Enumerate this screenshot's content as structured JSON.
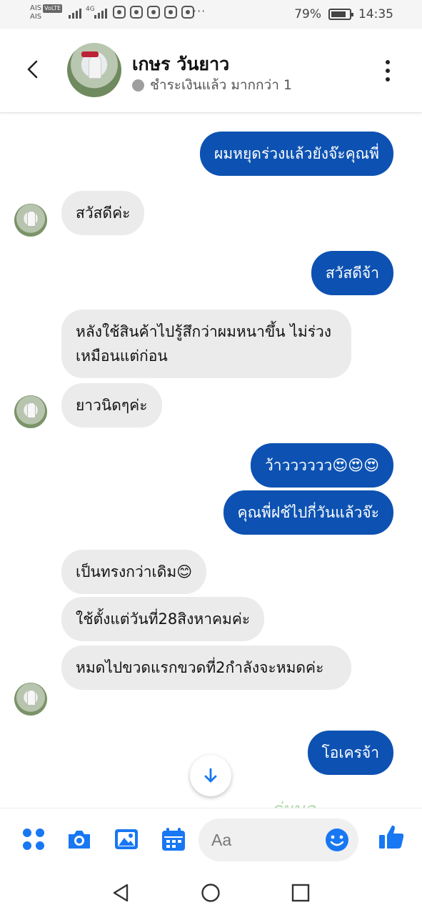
{
  "status_bar": {
    "carrier_top": "AIS",
    "volte": "VoLTE",
    "carrier_bottom": "AIS",
    "net_type": "4G",
    "dots": "···",
    "battery_percent": "79%",
    "time": "14:35"
  },
  "header": {
    "contact_name": "เกษร วันยาว",
    "status_text": "ชำระเงินแล้ว มากกว่า 1"
  },
  "messages": [
    {
      "dir": "out",
      "text": "ผมหยุดร่วงแล้วยังจ๊ะคุณพี่"
    },
    {
      "dir": "in",
      "text": "สวัสดีค่ะ"
    },
    {
      "dir": "out",
      "text": "สวัสดีจ้า"
    },
    {
      "dir": "in",
      "text": "หลังใช้สินค้าไปรู้สึกว่าผมหนาขึ้น ไม่ร่วงเหมือนแต่ก่อน"
    },
    {
      "dir": "in",
      "text": "ยาวนิดๆค่ะ"
    },
    {
      "dir": "out",
      "text": "ว้าวววววว😍😍😍"
    },
    {
      "dir": "out",
      "text": "คุณพี่ฝช้ไปกี่วันแล้วจ๊ะ"
    },
    {
      "dir": "in",
      "text": "เป็นทรงกว่าเดิม😊"
    },
    {
      "dir": "in",
      "text": "ใช้ตั้งแต่วันที่28สิงหาคมค่ะ"
    },
    {
      "dir": "in",
      "text": "หมดไปขวดแรกขวดที่2กำลังจะหมดค่ะ"
    },
    {
      "dir": "out",
      "text": "โอเครจ้า"
    }
  ],
  "watermark_text": "ร่ผมสุ",
  "composer": {
    "placeholder": "Aa"
  },
  "colors": {
    "accent": "#0d52b2",
    "icon_blue": "#1877f2",
    "incoming_bg": "#ebebeb"
  },
  "icons": [
    "back-arrow-icon",
    "more-vertical-icon",
    "apps-grid-icon",
    "camera-icon",
    "gallery-icon",
    "calendar-icon",
    "emoji-icon",
    "thumbs-up-icon",
    "arrow-down-icon",
    "nav-back-icon",
    "nav-home-icon",
    "nav-recents-icon"
  ]
}
